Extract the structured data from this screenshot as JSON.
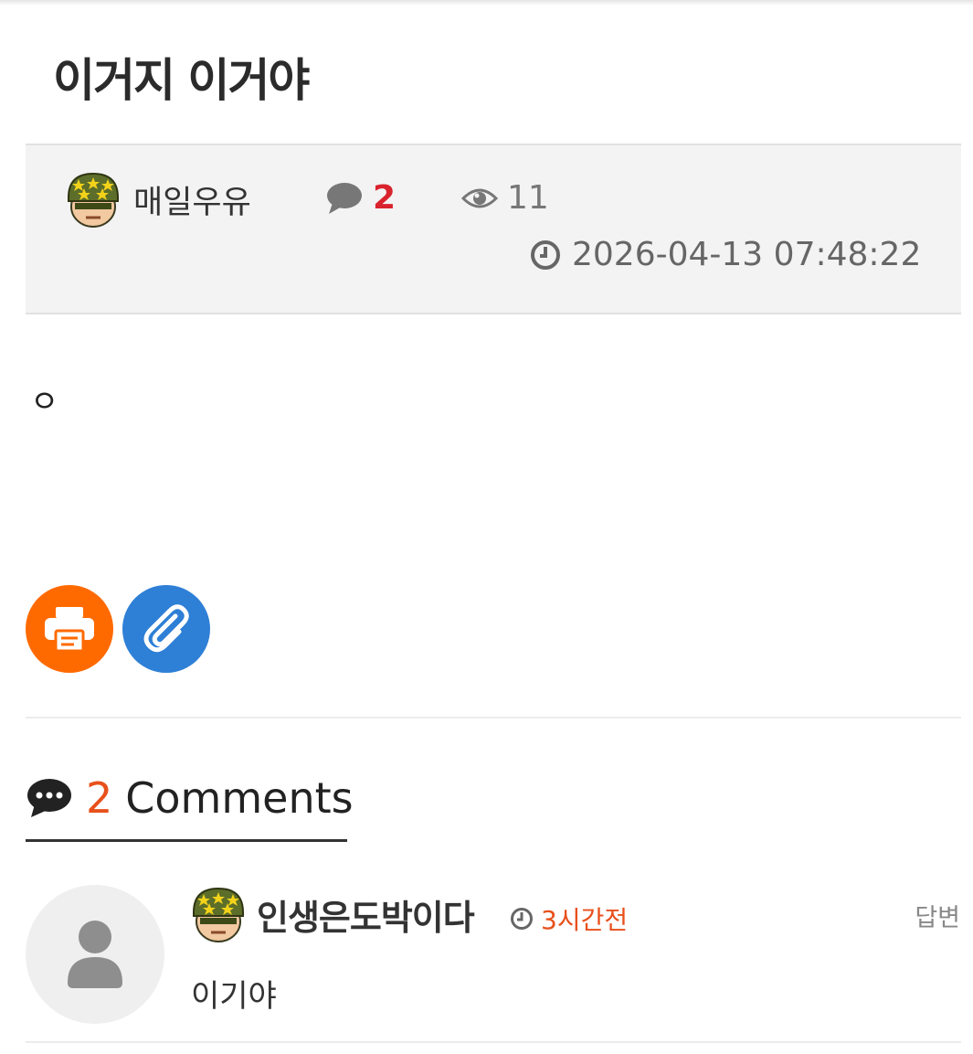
{
  "post": {
    "title": "이거지 이거야",
    "author": "매일우유",
    "comment_count": "2",
    "view_count": "11",
    "datetime": "2026-04-13 07:48:22",
    "body": "ㅇ"
  },
  "actions": {
    "print_icon": "printer-icon",
    "link_icon": "paperclip-icon"
  },
  "comments": {
    "count": "2",
    "label": "Comments",
    "items": [
      {
        "author": "인생은도박이다",
        "time": "3시간전",
        "reply_label": "답변",
        "text": "이기야"
      }
    ]
  },
  "colors": {
    "accent": "#e8501b",
    "comment_count_red": "#d9232d",
    "print_orange": "#ff6a00",
    "link_blue": "#2e7fd6",
    "meta_bg": "#f3f3f3"
  }
}
